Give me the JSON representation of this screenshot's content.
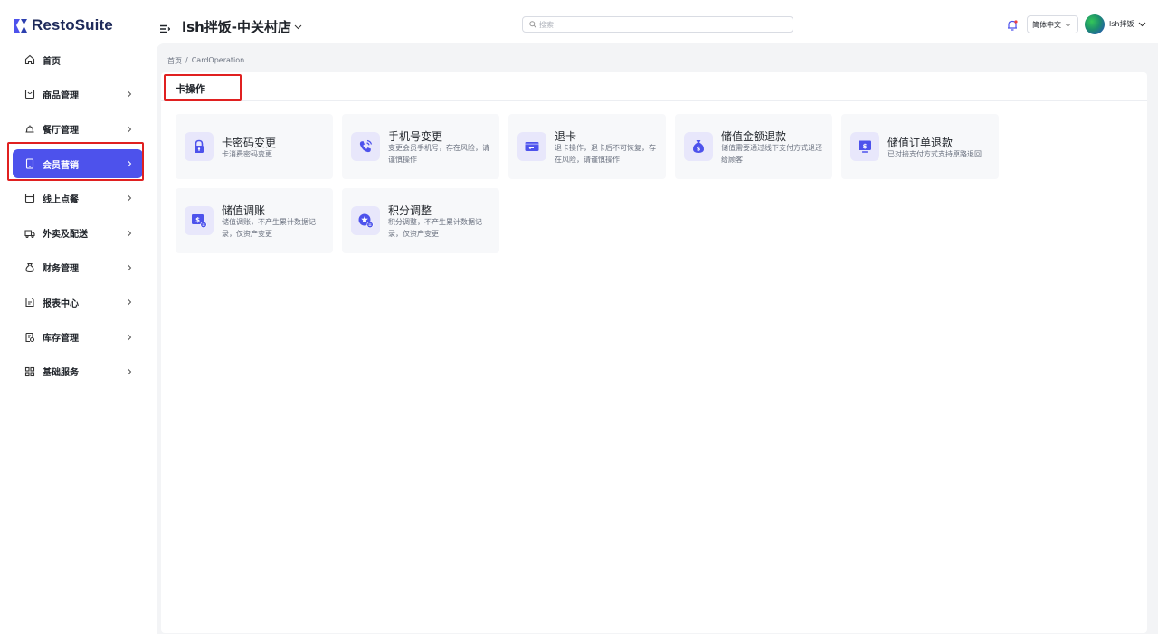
{
  "app": {
    "brand": "RestoSuite",
    "accent": "#4d52ec",
    "highlight": "#e02020"
  },
  "header": {
    "store_name": "lsh拌饭-中关村店",
    "search_placeholder": "搜索",
    "language": "简体中文",
    "user_name": "lsh拌饭"
  },
  "sidebar": {
    "items": [
      {
        "label": "首页",
        "icon": "home-icon",
        "has_children": false
      },
      {
        "label": "商品管理",
        "icon": "product-icon",
        "has_children": true
      },
      {
        "label": "餐厅管理",
        "icon": "restaurant-icon",
        "has_children": true
      },
      {
        "label": "会员营销",
        "icon": "member-icon",
        "has_children": true,
        "active": true
      },
      {
        "label": "线上点餐",
        "icon": "online-order-icon",
        "has_children": true
      },
      {
        "label": "外卖及配送",
        "icon": "delivery-icon",
        "has_children": true
      },
      {
        "label": "财务管理",
        "icon": "finance-icon",
        "has_children": true
      },
      {
        "label": "报表中心",
        "icon": "report-icon",
        "has_children": true
      },
      {
        "label": "库存管理",
        "icon": "inventory-icon",
        "has_children": true
      },
      {
        "label": "基础服务",
        "icon": "grid-icon",
        "has_children": true
      }
    ]
  },
  "breadcrumb": {
    "home": "首页",
    "separator": "/",
    "current": "CardOperation"
  },
  "page": {
    "title": "卡操作"
  },
  "operations": [
    {
      "title": "卡密码变更",
      "desc": "卡消费密码变更",
      "icon": "lock-icon"
    },
    {
      "title": "手机号变更",
      "desc": "变更会员手机号，存在风险，请谨慎操作",
      "icon": "phone-icon"
    },
    {
      "title": "退卡",
      "desc": "退卡操作，退卡后不可恢复，存在风险，请谨慎操作",
      "icon": "card-return-icon"
    },
    {
      "title": "储值金额退款",
      "desc": "储值需要通过线下支付方式退还给顾客",
      "icon": "money-bag-icon"
    },
    {
      "title": "储值订单退款",
      "desc": "已对接支付方式支持原路退回",
      "icon": "monitor-dollar-icon"
    },
    {
      "title": "储值调账",
      "desc": "储值调账，不产生累计数据记录，仅资产变更",
      "icon": "dollar-adjust-icon"
    },
    {
      "title": "积分调整",
      "desc": "积分调整，不产生累计数据记录，仅资产变更",
      "icon": "points-star-icon"
    }
  ]
}
